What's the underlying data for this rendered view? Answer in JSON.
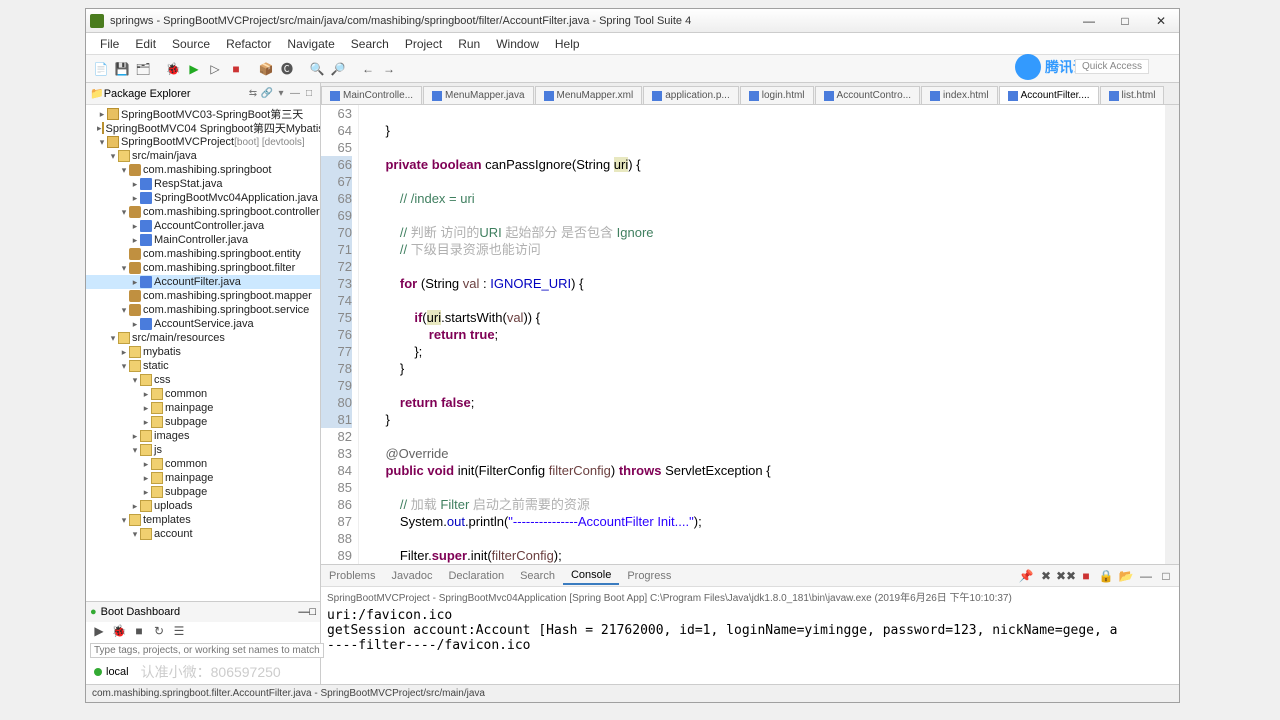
{
  "title": "springws - SpringBootMVCProject/src/main/java/com/mashibing/springboot/filter/AccountFilter.java - Spring Tool Suite 4",
  "menu": [
    "File",
    "Edit",
    "Source",
    "Refactor",
    "Navigate",
    "Search",
    "Project",
    "Run",
    "Window",
    "Help"
  ],
  "quick_access": "Quick Access",
  "watermark": "腾讯课堂",
  "pkg_explorer": {
    "title": "Package Explorer",
    "items": [
      {
        "d": 1,
        "a": "▸",
        "ic": "proj",
        "t": "SpringBootMVC03-SpringBoot第三天"
      },
      {
        "d": 1,
        "a": "▸",
        "ic": "proj",
        "t": "SpringBootMVC04 Springboot第四天Mybatis"
      },
      {
        "d": 1,
        "a": "▾",
        "ic": "proj",
        "t": "SpringBootMVCProject",
        "tag": "[boot] [devtools]"
      },
      {
        "d": 2,
        "a": "▾",
        "ic": "fold",
        "t": "src/main/java"
      },
      {
        "d": 3,
        "a": "▾",
        "ic": "pkg",
        "t": "com.mashibing.springboot"
      },
      {
        "d": 4,
        "a": "▸",
        "ic": "java",
        "t": "RespStat.java"
      },
      {
        "d": 4,
        "a": "▸",
        "ic": "java",
        "t": "SpringBootMvc04Application.java"
      },
      {
        "d": 3,
        "a": "▾",
        "ic": "pkg",
        "t": "com.mashibing.springboot.controller"
      },
      {
        "d": 4,
        "a": "▸",
        "ic": "java",
        "t": "AccountController.java"
      },
      {
        "d": 4,
        "a": "▸",
        "ic": "java",
        "t": "MainController.java"
      },
      {
        "d": 3,
        "a": "",
        "ic": "pkg",
        "t": "com.mashibing.springboot.entity"
      },
      {
        "d": 3,
        "a": "▾",
        "ic": "pkg",
        "t": "com.mashibing.springboot.filter"
      },
      {
        "d": 4,
        "a": "▸",
        "ic": "java",
        "t": "AccountFilter.java",
        "sel": true
      },
      {
        "d": 3,
        "a": "",
        "ic": "pkg",
        "t": "com.mashibing.springboot.mapper"
      },
      {
        "d": 3,
        "a": "▾",
        "ic": "pkg",
        "t": "com.mashibing.springboot.service"
      },
      {
        "d": 4,
        "a": "▸",
        "ic": "java",
        "t": "AccountService.java"
      },
      {
        "d": 2,
        "a": "▾",
        "ic": "fold",
        "t": "src/main/resources"
      },
      {
        "d": 3,
        "a": "▸",
        "ic": "fold",
        "t": "mybatis"
      },
      {
        "d": 3,
        "a": "▾",
        "ic": "fold",
        "t": "static"
      },
      {
        "d": 4,
        "a": "▾",
        "ic": "fold",
        "t": "css"
      },
      {
        "d": 5,
        "a": "▸",
        "ic": "fold",
        "t": "common"
      },
      {
        "d": 5,
        "a": "▸",
        "ic": "fold",
        "t": "mainpage"
      },
      {
        "d": 5,
        "a": "▸",
        "ic": "fold",
        "t": "subpage"
      },
      {
        "d": 4,
        "a": "▸",
        "ic": "fold",
        "t": "images"
      },
      {
        "d": 4,
        "a": "▾",
        "ic": "fold",
        "t": "js"
      },
      {
        "d": 5,
        "a": "▸",
        "ic": "fold",
        "t": "common"
      },
      {
        "d": 5,
        "a": "▸",
        "ic": "fold",
        "t": "mainpage"
      },
      {
        "d": 5,
        "a": "▸",
        "ic": "fold",
        "t": "subpage"
      },
      {
        "d": 4,
        "a": "▸",
        "ic": "fold",
        "t": "uploads"
      },
      {
        "d": 3,
        "a": "▾",
        "ic": "fold",
        "t": "templates"
      },
      {
        "d": 4,
        "a": "▾",
        "ic": "fold",
        "t": "account"
      }
    ]
  },
  "boot_dash": {
    "title": "Boot Dashboard",
    "filter_placeholder": "Type tags, projects, or working set names to match (in",
    "entry": "local",
    "faded_text": "认准小微：806597250"
  },
  "editor_tabs": [
    {
      "label": "MainControlle..."
    },
    {
      "label": "MenuMapper.java"
    },
    {
      "label": "MenuMapper.xml"
    },
    {
      "label": "application.p..."
    },
    {
      "label": "login.html"
    },
    {
      "label": "AccountContro..."
    },
    {
      "label": "index.html"
    },
    {
      "label": "AccountFilter....",
      "active": true
    },
    {
      "label": "list.html"
    }
  ],
  "code": {
    "start": 63,
    "lines": [
      "",
      "    }",
      "",
      "    <kw>private</kw> <kw>boolean</kw> canPassIgnore(String <hl>uri</hl>) {",
      "",
      "        <cmt>// /index = uri</cmt>",
      "",
      "        <cmt>//</cmt> <cmt-cn>判断 访问的</cmt-cn><cmt>URI</cmt> <cmt-cn>起始部分 是否包含</cmt-cn> <cmt>Ignore</cmt>",
      "        <cmt>//</cmt> <cmt-cn>下级目录资源也能访问</cmt-cn>",
      "",
      "        <kw>for</kw> (String <param>val</param> : <fld>IGNORE_URI</fld>) {",
      "",
      "            <kw>if</kw>(<hl>uri</hl>.startsWith(<param>val</param>)) {",
      "                <kw>return</kw> <kw>true</kw>;",
      "            };",
      "        }",
      "",
      "        <kw>return</kw> <kw>false</kw>;",
      "    }",
      "",
      "    <ann>@Override</ann>",
      "    <kw>public</kw> <kw>void</kw> init(FilterConfig <param>filterConfig</param>) <kw>throws</kw> ServletException {",
      "",
      "        <cmt>//</cmt> <cmt-cn>加载</cmt-cn> <cmt>Filter</cmt> <cmt-cn>启动之前需要的资源</cmt-cn>",
      "        System.<fld>out</fld>.println(<str>\"---------------AccountFilter Init....\"</str>);",
      "",
      "        Filter.<kw>super</kw>.init(<param>filterConfig</param>);",
      "    }"
    ]
  },
  "bottom": {
    "tabs": [
      "Problems",
      "Javadoc",
      "Declaration",
      "Search",
      "Console",
      "Progress"
    ],
    "active": "Console",
    "launch": "SpringBootMVCProject - SpringBootMvc04Application [Spring Boot App] C:\\Program Files\\Java\\jdk1.8.0_181\\bin\\javaw.exe (2019年6月26日 下午10:10:37)",
    "lines": [
      "uri:/favicon.ico",
      "getSession account:Account [Hash = 21762000, id=1, loginName=yimingge, password=123, nickName=gege, a",
      "----filter----/favicon.ico"
    ]
  },
  "statusbar": "com.mashibing.springboot.filter.AccountFilter.java - SpringBootMVCProject/src/main/java"
}
